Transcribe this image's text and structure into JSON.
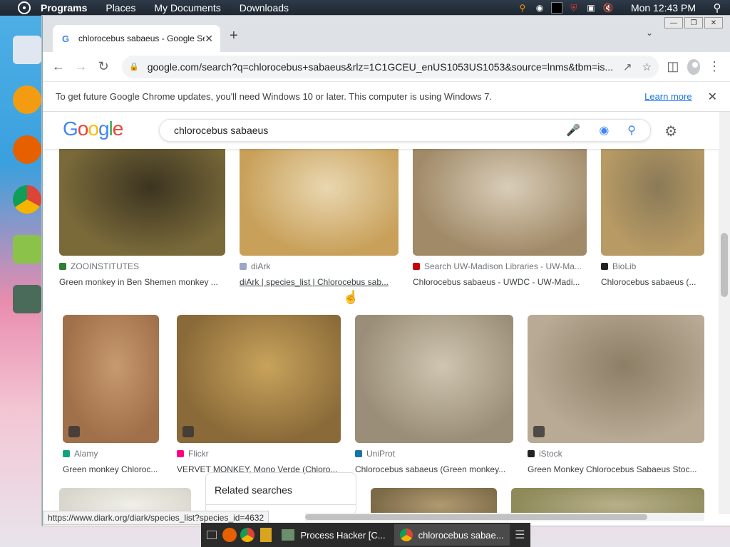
{
  "topbar": {
    "menu": [
      "Programs",
      "Places",
      "My Documents",
      "Downloads"
    ],
    "clock": "Mon 12:43 PM"
  },
  "browser": {
    "tab_title": "chlorocebus sabaeus - Google Se",
    "url": "google.com/search?q=chlorocebus+sabaeus&rlz=1C1GCEU_enUS1053US1053&source=lnms&tbm=is...",
    "infobar_message": "To get future Google Chrome updates, you'll need Windows 10 or later. This computer is using Windows 7.",
    "infobar_link": "Learn more",
    "status_url": "https://www.diark.org/diark/species_list?species_id=4632"
  },
  "google": {
    "logo": "Google",
    "query": "chlorocebus sabaeus",
    "related_label": "Related searches"
  },
  "results": [
    {
      "source": "ZOOINSTITUTES",
      "title": "Green monkey in Ben Shemen monkey ...",
      "fav_color": "#2e7d32",
      "img": [
        "#7a6a3a",
        "#3b3420"
      ]
    },
    {
      "source": "diArk",
      "title": "diArk | species_list | Chlorocebus sab...",
      "fav_color": "#9aa7c4",
      "img": [
        "#c8a05a",
        "#e9d7b0"
      ]
    },
    {
      "source": "Search UW-Madison Libraries - UW-Ma...",
      "title": "Chlorocebus sabaeus - UWDC - UW-Madi...",
      "fav_color": "#c5050c",
      "img": [
        "#a08a68",
        "#d9cdb8"
      ]
    },
    {
      "source": "BioLib",
      "title": "Chlorocebus sabaeus (...",
      "fav_color": "#222222",
      "img": [
        "#b79a64",
        "#8a7a58"
      ]
    },
    {
      "source": "Alamy",
      "title": "Green monkey Chloroc...",
      "fav_color": "#10a37f",
      "img": [
        "#a0704a",
        "#c89a6e"
      ]
    },
    {
      "source": "Flickr",
      "title": "VERVET MONKEY, Mono Verde (Chloro...",
      "fav_color": "#ff0084",
      "img": [
        "#8a6a38",
        "#c8a35c"
      ]
    },
    {
      "source": "UniProt",
      "title": "Chlorocebus sabaeus (Green monkey...",
      "fav_color": "#1a73a8",
      "img": [
        "#9a8e78",
        "#cfc5b0"
      ]
    },
    {
      "source": "iStock",
      "title": "Green Monkey Chlorocebus Sabaeus Stoc...",
      "fav_color": "#222222",
      "img": [
        "#b8aa94",
        "#8d7e66"
      ]
    },
    {
      "source": "",
      "title": "",
      "fav_color": "#ffffff",
      "img": [
        "#d8d6cc",
        "#f0efe8"
      ]
    },
    {
      "source": "",
      "title": "",
      "fav_color": "#ffffff",
      "img": [
        "#7c6a48",
        "#b09a70"
      ]
    },
    {
      "source": "",
      "title": "",
      "fav_color": "#ffffff",
      "img": [
        "#8e8a5a",
        "#b8b08a"
      ]
    }
  ],
  "taskbar": {
    "tasks": [
      "Process Hacker [C...",
      "chlorocebus sabae..."
    ]
  }
}
